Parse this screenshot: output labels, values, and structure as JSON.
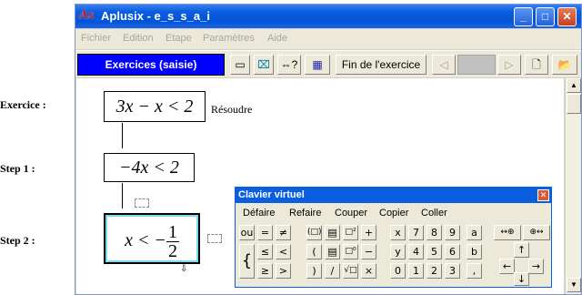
{
  "labels": {
    "exercice": "Exercice :",
    "step1": "Step 1 :",
    "step2": "Step 2 :"
  },
  "window": {
    "app_icon": "Ax",
    "title": "Aplusix - e_s_s_a_i",
    "buttons": {
      "minimize": "_",
      "maximize": "□",
      "close": "✕"
    }
  },
  "menu": [
    "Fichier",
    "Edition",
    "Etape",
    "Paramètres",
    "Aide"
  ],
  "toolbar": {
    "mode": "Exercices (saisie)",
    "b1": "▭",
    "b2": "⌧",
    "b3": "⇔?",
    "b4": "▦",
    "end_exercise": "Fin de l'exercice",
    "prev": "◁",
    "next": "▷",
    "new_icon": "🗋",
    "open_icon": "📂"
  },
  "work": {
    "exercise_expr": "3x − x < 2",
    "resoudre": "Résoudre",
    "step1_expr": "−4x < 2",
    "step2_left": "x < −",
    "step2_num": "1",
    "step2_den": "2",
    "move_icon": "⇩"
  },
  "keyboard": {
    "title": "Clavier virtuel",
    "close": "✕",
    "menu": [
      "Défaire",
      "Refaire",
      "Couper",
      "Copier",
      "Coller"
    ],
    "keys": {
      "ou": "ou",
      "eq": "=",
      "neq": "≠",
      "paren_sq": "(□)",
      "fracbox": "▤",
      "sq": "□²",
      "plus": "+",
      "le": "≤",
      "lt": "<",
      "lparen": "(",
      "fracbox2": "▤",
      "pow0": "□⁰",
      "minus": "−",
      "brace": "{",
      "ge": "≥",
      "gt": ">",
      "rparen": ")",
      "slash": "/",
      "sqrt": "√□",
      "times": "×",
      "x": "x",
      "n7": "7",
      "n8": "8",
      "n9": "9",
      "a": "a",
      "y": "y",
      "n4": "4",
      "n5": "5",
      "n6": "6",
      "b": "b",
      "n0": "0",
      "n1": "1",
      "n2": "2",
      "n3": "3",
      "comma": ",",
      "nav1": "↔⊕",
      "nav2": "⊕↔",
      "up": "↑",
      "left": "←",
      "right": "→",
      "down": "↓",
      "enter_l": "↵",
      "enter_r": "↳"
    }
  }
}
